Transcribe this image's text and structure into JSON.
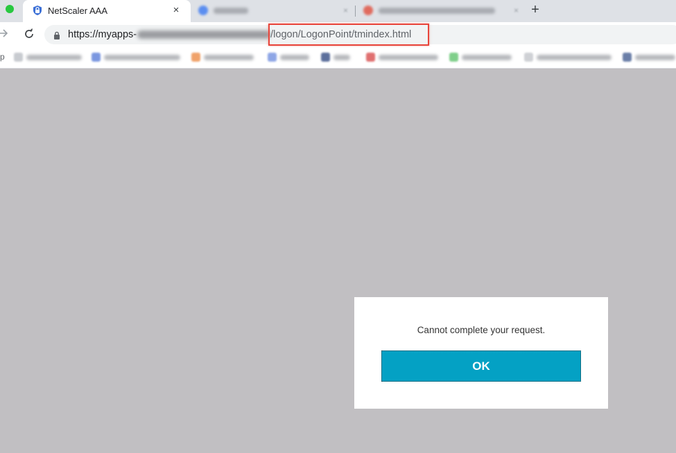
{
  "browser": {
    "active_tab": {
      "title": "NetScaler AAA",
      "close_glyph": "×",
      "icon": "netscaler-lock-icon"
    },
    "new_tab_glyph": "+",
    "url": {
      "scheme_host_prefix": "https://myapps-",
      "redacted_middle": "[redacted]",
      "path": "/logon/LogonPoint/tmindex.html"
    },
    "colors": {
      "highlight": "#e8443a",
      "tabstrip": "#dee1e6"
    }
  },
  "bookmarks": {
    "first_fragment": "p"
  },
  "dialog": {
    "message": "Cannot complete your request.",
    "ok_label": "OK",
    "button_color": "#04a1c4"
  },
  "page": {
    "background_color": "#c1bfc2"
  }
}
